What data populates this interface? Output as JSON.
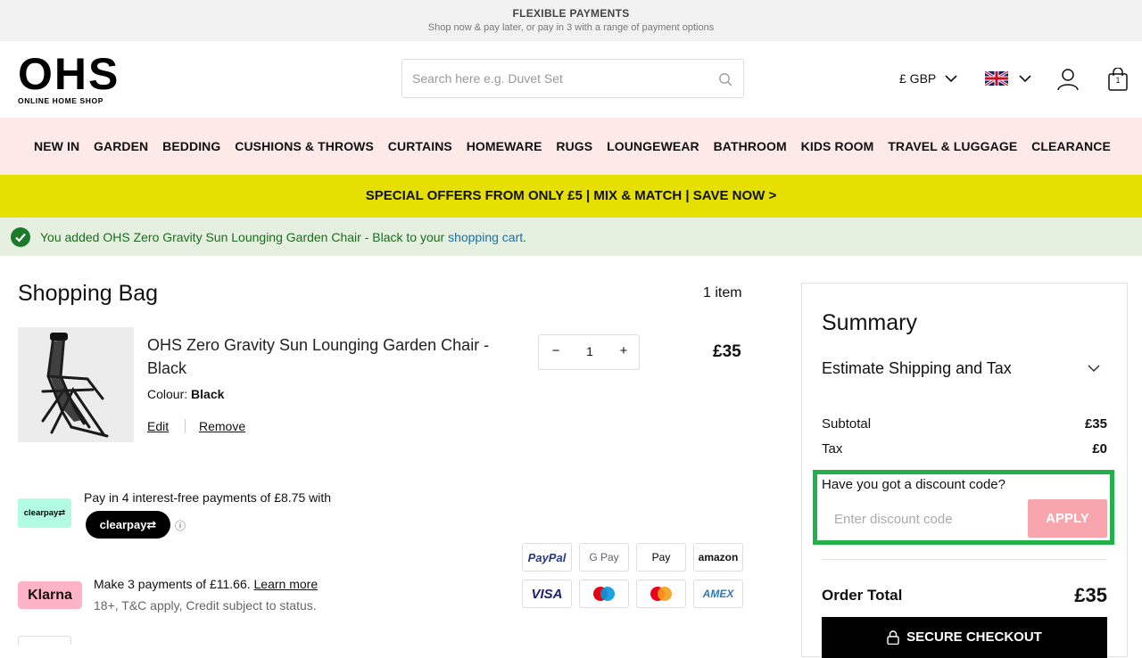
{
  "promo": {
    "title": "FLEXIBLE PAYMENTS",
    "subtitle": "Shop now & pay later, or pay in 3 with a range of payment options"
  },
  "header": {
    "logo_main": "OHS",
    "logo_sub": "ONLINE HOME SHOP",
    "search_placeholder": "Search here e.g. Duvet Set",
    "search_value": "",
    "currency": "£ GBP",
    "bag_count": "1"
  },
  "nav": {
    "items": [
      "NEW IN",
      "GARDEN",
      "BEDDING",
      "CUSHIONS & THROWS",
      "CURTAINS",
      "HOMEWARE",
      "RUGS",
      "LOUNGEWEAR",
      "BATHROOM",
      "KIDS ROOM",
      "TRAVEL & LUGGAGE",
      "CLEARANCE"
    ]
  },
  "offer": {
    "text": "SPECIAL OFFERS FROM ONLY £5 | MIX & MATCH | SAVE NOW >"
  },
  "message": {
    "text_before": "You added OHS Zero Gravity Sun Lounging Garden Chair - Black to your ",
    "link": "shopping cart",
    "text_after": "."
  },
  "bag": {
    "title": "Shopping Bag",
    "item_count": "1 item",
    "product": {
      "name": "OHS Zero Gravity Sun Lounging Garden Chair - Black",
      "colour_label": "Colour:",
      "colour_value": "Black",
      "edit_label": "Edit",
      "remove_label": "Remove",
      "quantity": "1",
      "minus": "−",
      "plus": "+",
      "price": "£35"
    }
  },
  "clearpay": {
    "badge": "clearpay⇄",
    "text": "Pay in 4 interest-free payments of £8.75 with",
    "pill": "clearpay⇄",
    "info": "ⓘ"
  },
  "klarna": {
    "badge": "Klarna",
    "text": "Make 3 payments of £11.66. ",
    "link": "Learn more",
    "sub": "18+, T&C apply, Credit subject to status."
  },
  "payment_methods": [
    "PayPal",
    "G Pay",
    " Pay",
    "amazon",
    "VISA",
    "maestro",
    "mastercard",
    "AMEX"
  ],
  "summary": {
    "title": "Summary",
    "estimate": "Estimate Shipping and Tax",
    "subtotal_label": "Subtotal",
    "subtotal_value": "£35",
    "tax_label": "Tax",
    "tax_value": "£0",
    "discount_question": "Have you got a discount code?",
    "discount_placeholder": "Enter discount code",
    "discount_value": "",
    "apply_label": "APPLY",
    "order_total_label": "Order Total",
    "order_total_value": "£35",
    "checkout_label": "SECURE CHECKOUT"
  },
  "colors": {
    "nav_bg": "#fde9e8",
    "offer_bg": "#e6e000",
    "message_bg": "#e5f0e1",
    "apply_bg": "#f8a5ad",
    "highlight": "#21b24b"
  }
}
